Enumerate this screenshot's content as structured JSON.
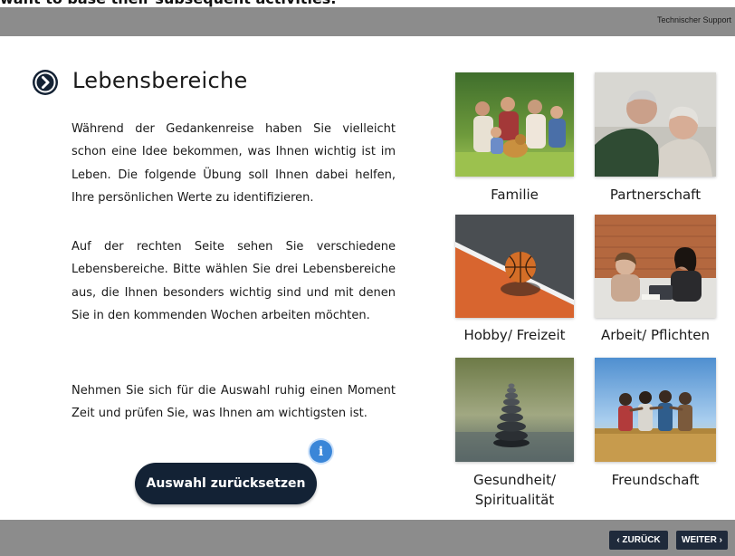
{
  "caption": "want to base their subsequent activities.",
  "header": {
    "support_label": "Technischer Support"
  },
  "content": {
    "title": "Lebensbereiche",
    "paragraphs": [
      "Während der Gedankenreise haben Sie vielleicht schon eine Idee bekommen, was Ihnen wichtig ist im Leben. Die folgende Übung soll Ihnen dabei helfen, Ihre persönlichen Werte zu identifizieren.",
      "Auf der rechten Seite sehen Sie verschiedene Lebensbereiche. Bitte wählen Sie drei Lebensbereiche aus, die Ihnen besonders wichtig sind und mit denen Sie in den kommenden Wochen arbeiten möchten.",
      "Nehmen Sie sich für die Auswahl ruhig einen Moment Zeit und prüfen Sie, was Ihnen am wichtigsten ist."
    ],
    "info_symbol": "i",
    "reset_button": "Auswahl zurücksetzen"
  },
  "areas": [
    {
      "label": "Familie",
      "image": "family-photo"
    },
    {
      "label": "Partnerschaft",
      "image": "couple-photo"
    },
    {
      "label": "Hobby/ Freizeit",
      "image": "basketball-photo"
    },
    {
      "label": "Arbeit/ Pflichten",
      "image": "office-meeting-photo"
    },
    {
      "label": "Gesundheit/ Spiritualität",
      "image": "stacked-stones-photo"
    },
    {
      "label": "Freundschaft",
      "image": "friends-field-photo"
    }
  ],
  "footer": {
    "back_label": "‹ ZURÜCK",
    "next_label": "WEITER ›"
  },
  "colors": {
    "bar_gray": "#8c8c8c",
    "navy": "#132235",
    "info_blue": "#3a86d8"
  }
}
